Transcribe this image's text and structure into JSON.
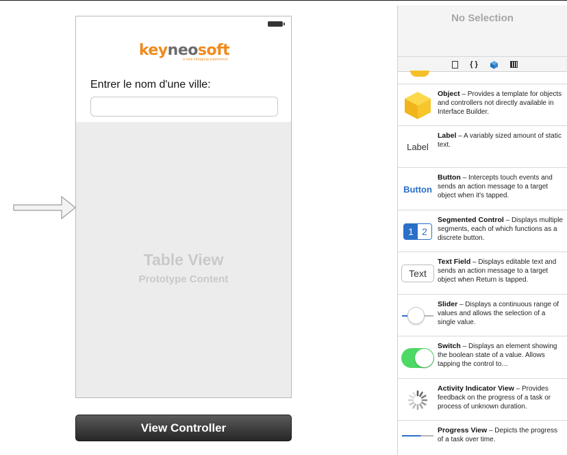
{
  "canvas": {
    "logo": {
      "key": "key",
      "neo": "neo",
      "soft": "soft",
      "tagline": "a new shopping experience"
    },
    "city_label": "Entrer le nom d'une ville:",
    "city_input_value": "",
    "table_view": {
      "title": "Table View",
      "subtitle": "Prototype Content"
    },
    "scene_bar_label": "View Controller"
  },
  "inspector": {
    "no_selection": "No Selection"
  },
  "library": {
    "tabs": [
      "file-icon",
      "code-braces-icon",
      "object-cube-icon",
      "media-icon"
    ],
    "items": [
      {
        "name": "Object",
        "desc": " – Provides a template for objects and controllers not directly available in Interface Builder.",
        "icon": "object-cube-icon"
      },
      {
        "name": "Label",
        "desc": " – A variably sized amount of static text.",
        "icon": "label-icon",
        "icon_text": "Label"
      },
      {
        "name": "Button",
        "desc": " – Intercepts touch events and sends an action message to a target object when it's tapped.",
        "icon": "button-icon",
        "icon_text": "Button"
      },
      {
        "name": "Segmented Control",
        "desc": " – Displays multiple segments, each of which functions as a discrete button.",
        "icon": "segmented-control-icon",
        "seg1": "1",
        "seg2": "2"
      },
      {
        "name": "Text Field",
        "desc": " – Displays editable text and sends an action message to a target object when Return is tapped.",
        "icon": "text-field-icon",
        "icon_text": "Text"
      },
      {
        "name": "Slider",
        "desc": " – Displays a continuous range of values and allows the selection of a single value.",
        "icon": "slider-icon"
      },
      {
        "name": "Switch",
        "desc": " – Displays an element showing the boolean state of a value. Allows tapping the control to…",
        "icon": "switch-icon"
      },
      {
        "name": "Activity Indicator View",
        "desc": " – Provides feedback on the progress of a task or process of unknown duration.",
        "icon": "activity-indicator-icon"
      },
      {
        "name": "Progress View",
        "desc": " – Depicts the progress of a task over time.",
        "icon": "progress-view-icon"
      }
    ]
  },
  "colors": {
    "accent_blue": "#2a6fc8",
    "switch_green": "#4cd964",
    "logo_orange": "#f08a1c",
    "object_yellow": "#f5c027"
  }
}
